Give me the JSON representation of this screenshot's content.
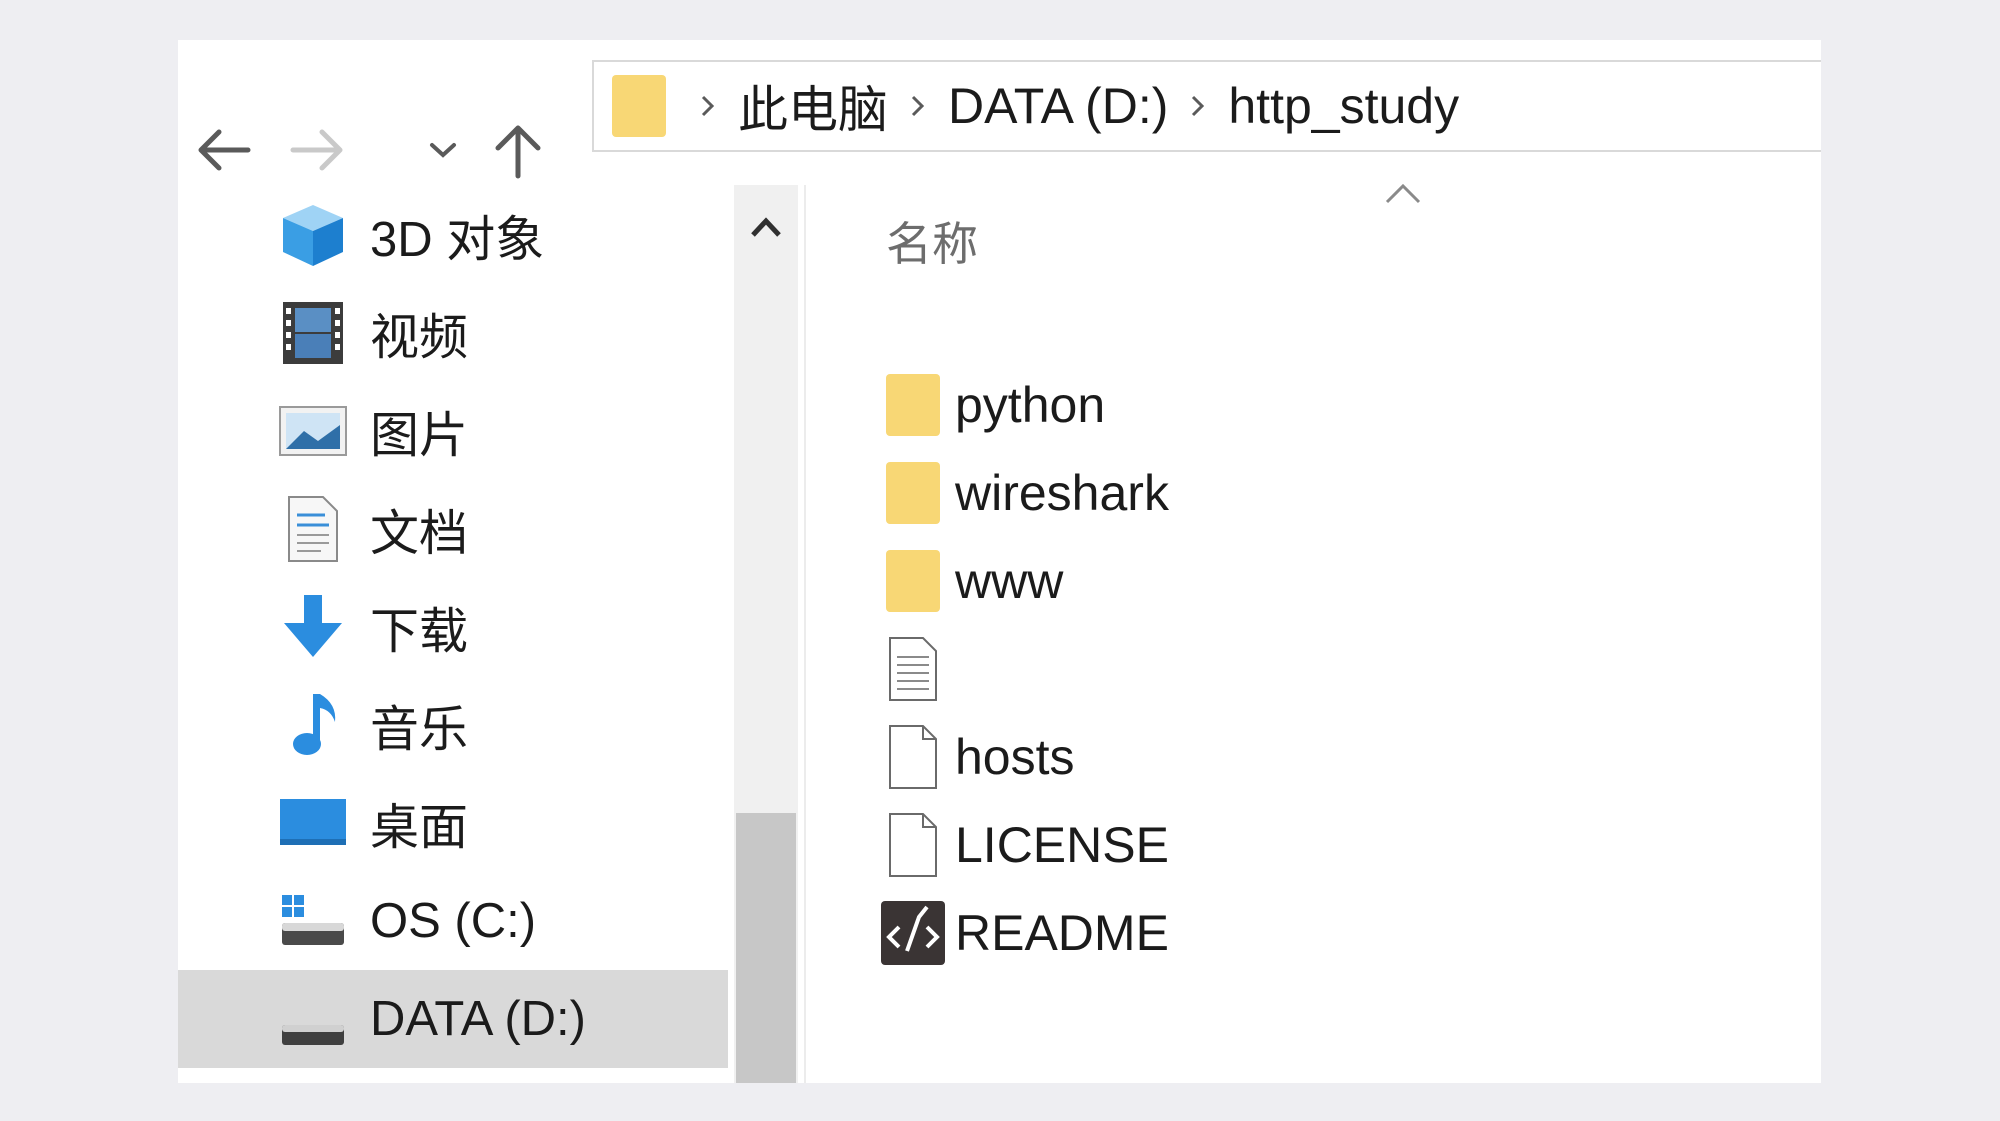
{
  "toolbar": {
    "back_icon": "arrow-left-icon",
    "forward_icon": "arrow-right-icon",
    "recent_icon": "chevron-down-icon",
    "up_icon": "arrow-up-icon"
  },
  "address_bar": {
    "crumbs": [
      {
        "label": "此电脑"
      },
      {
        "label": "DATA (D:)"
      },
      {
        "label": "http_study"
      }
    ]
  },
  "nav_pane": {
    "items": [
      {
        "label": "3D 对象",
        "icon": "3d-objects-icon"
      },
      {
        "label": "视频",
        "icon": "video-icon"
      },
      {
        "label": "图片",
        "icon": "pictures-icon"
      },
      {
        "label": "文档",
        "icon": "documents-icon"
      },
      {
        "label": "下载",
        "icon": "download-icon"
      },
      {
        "label": "音乐",
        "icon": "music-icon"
      },
      {
        "label": "桌面",
        "icon": "desktop-icon"
      },
      {
        "label": "OS (C:)",
        "icon": "system-drive-icon"
      },
      {
        "label": "DATA (D:)",
        "icon": "drive-icon",
        "selected": true
      }
    ]
  },
  "content": {
    "column_header": "名称",
    "files": [
      {
        "name": "python",
        "icon": "folder-icon"
      },
      {
        "name": "wireshark",
        "icon": "folder-icon"
      },
      {
        "name": "www",
        "icon": "folder-icon"
      },
      {
        "name": "",
        "icon": "text-file-icon"
      },
      {
        "name": "hosts",
        "icon": "file-icon"
      },
      {
        "name": "LICENSE",
        "icon": "file-icon"
      },
      {
        "name": "README",
        "icon": "markdown-file-icon"
      }
    ]
  },
  "colors": {
    "folder": "#f8d775",
    "selection": "#d9d9d9",
    "accent": "#2b8ddf"
  }
}
